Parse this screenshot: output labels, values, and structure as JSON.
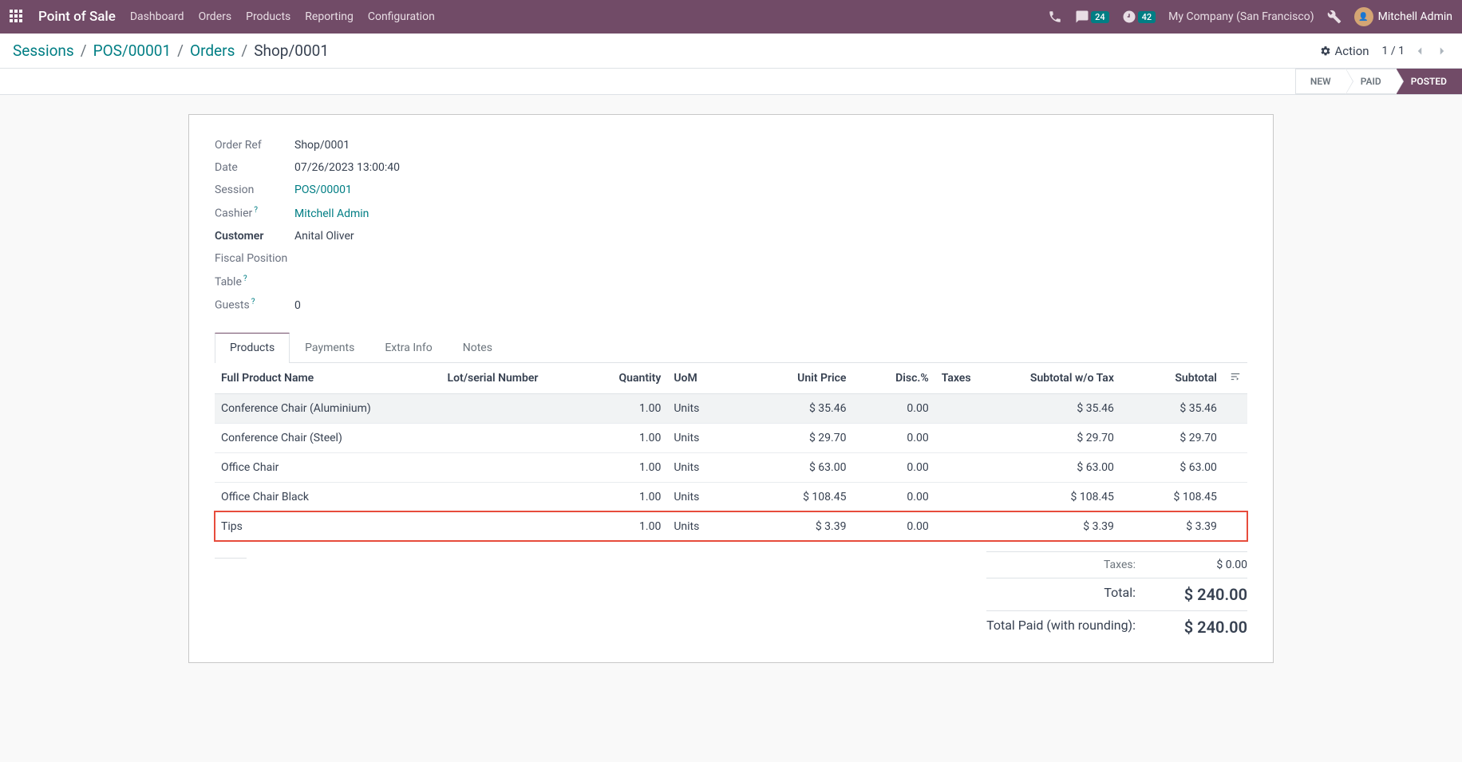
{
  "topnav": {
    "app_title": "Point of Sale",
    "menu": [
      "Dashboard",
      "Orders",
      "Products",
      "Reporting",
      "Configuration"
    ],
    "messages_badge": "24",
    "activities_badge": "42",
    "company": "My Company (San Francisco)",
    "username": "Mitchell Admin"
  },
  "breadcrumb": {
    "items": [
      "Sessions",
      "POS/00001",
      "Orders"
    ],
    "current": "Shop/0001"
  },
  "action_label": "Action",
  "pager": "1 / 1",
  "status_steps": {
    "s0": "NEW",
    "s1": "PAID",
    "s2": "POSTED"
  },
  "form": {
    "order_ref": {
      "label": "Order Ref",
      "value": "Shop/0001"
    },
    "date": {
      "label": "Date",
      "value": "07/26/2023 13:00:40"
    },
    "session": {
      "label": "Session",
      "value": "POS/00001"
    },
    "cashier": {
      "label": "Cashier",
      "value": "Mitchell Admin"
    },
    "customer": {
      "label": "Customer",
      "value": "Anital Oliver"
    },
    "fiscal": {
      "label": "Fiscal Position",
      "value": ""
    },
    "table": {
      "label": "Table",
      "value": ""
    },
    "guests": {
      "label": "Guests",
      "value": "0"
    }
  },
  "tabs": {
    "products": "Products",
    "payments": "Payments",
    "extra": "Extra Info",
    "notes": "Notes"
  },
  "table": {
    "headers": {
      "name": "Full Product Name",
      "lot": "Lot/serial Number",
      "qty": "Quantity",
      "uom": "UoM",
      "price": "Unit Price",
      "disc": "Disc.%",
      "taxes": "Taxes",
      "subtotal_wo": "Subtotal w/o Tax",
      "subtotal": "Subtotal"
    },
    "rows": [
      {
        "name": "Conference Chair (Aluminium)",
        "lot": "",
        "qty": "1.00",
        "uom": "Units",
        "price": "$ 35.46",
        "disc": "0.00",
        "taxes": "",
        "subtotal_wo": "$ 35.46",
        "subtotal": "$ 35.46"
      },
      {
        "name": "Conference Chair (Steel)",
        "lot": "",
        "qty": "1.00",
        "uom": "Units",
        "price": "$ 29.70",
        "disc": "0.00",
        "taxes": "",
        "subtotal_wo": "$ 29.70",
        "subtotal": "$ 29.70"
      },
      {
        "name": "Office Chair",
        "lot": "",
        "qty": "1.00",
        "uom": "Units",
        "price": "$ 63.00",
        "disc": "0.00",
        "taxes": "",
        "subtotal_wo": "$ 63.00",
        "subtotal": "$ 63.00"
      },
      {
        "name": "Office Chair Black",
        "lot": "",
        "qty": "1.00",
        "uom": "Units",
        "price": "$ 108.45",
        "disc": "0.00",
        "taxes": "",
        "subtotal_wo": "$ 108.45",
        "subtotal": "$ 108.45"
      },
      {
        "name": "Tips",
        "lot": "",
        "qty": "1.00",
        "uom": "Units",
        "price": "$ 3.39",
        "disc": "0.00",
        "taxes": "",
        "subtotal_wo": "$ 3.39",
        "subtotal": "$ 3.39"
      }
    ]
  },
  "totals": {
    "taxes": {
      "label": "Taxes:",
      "value": "$ 0.00"
    },
    "total": {
      "label": "Total:",
      "value": "$ 240.00"
    },
    "paid": {
      "label": "Total Paid (with rounding):",
      "value": "$ 240.00"
    }
  }
}
